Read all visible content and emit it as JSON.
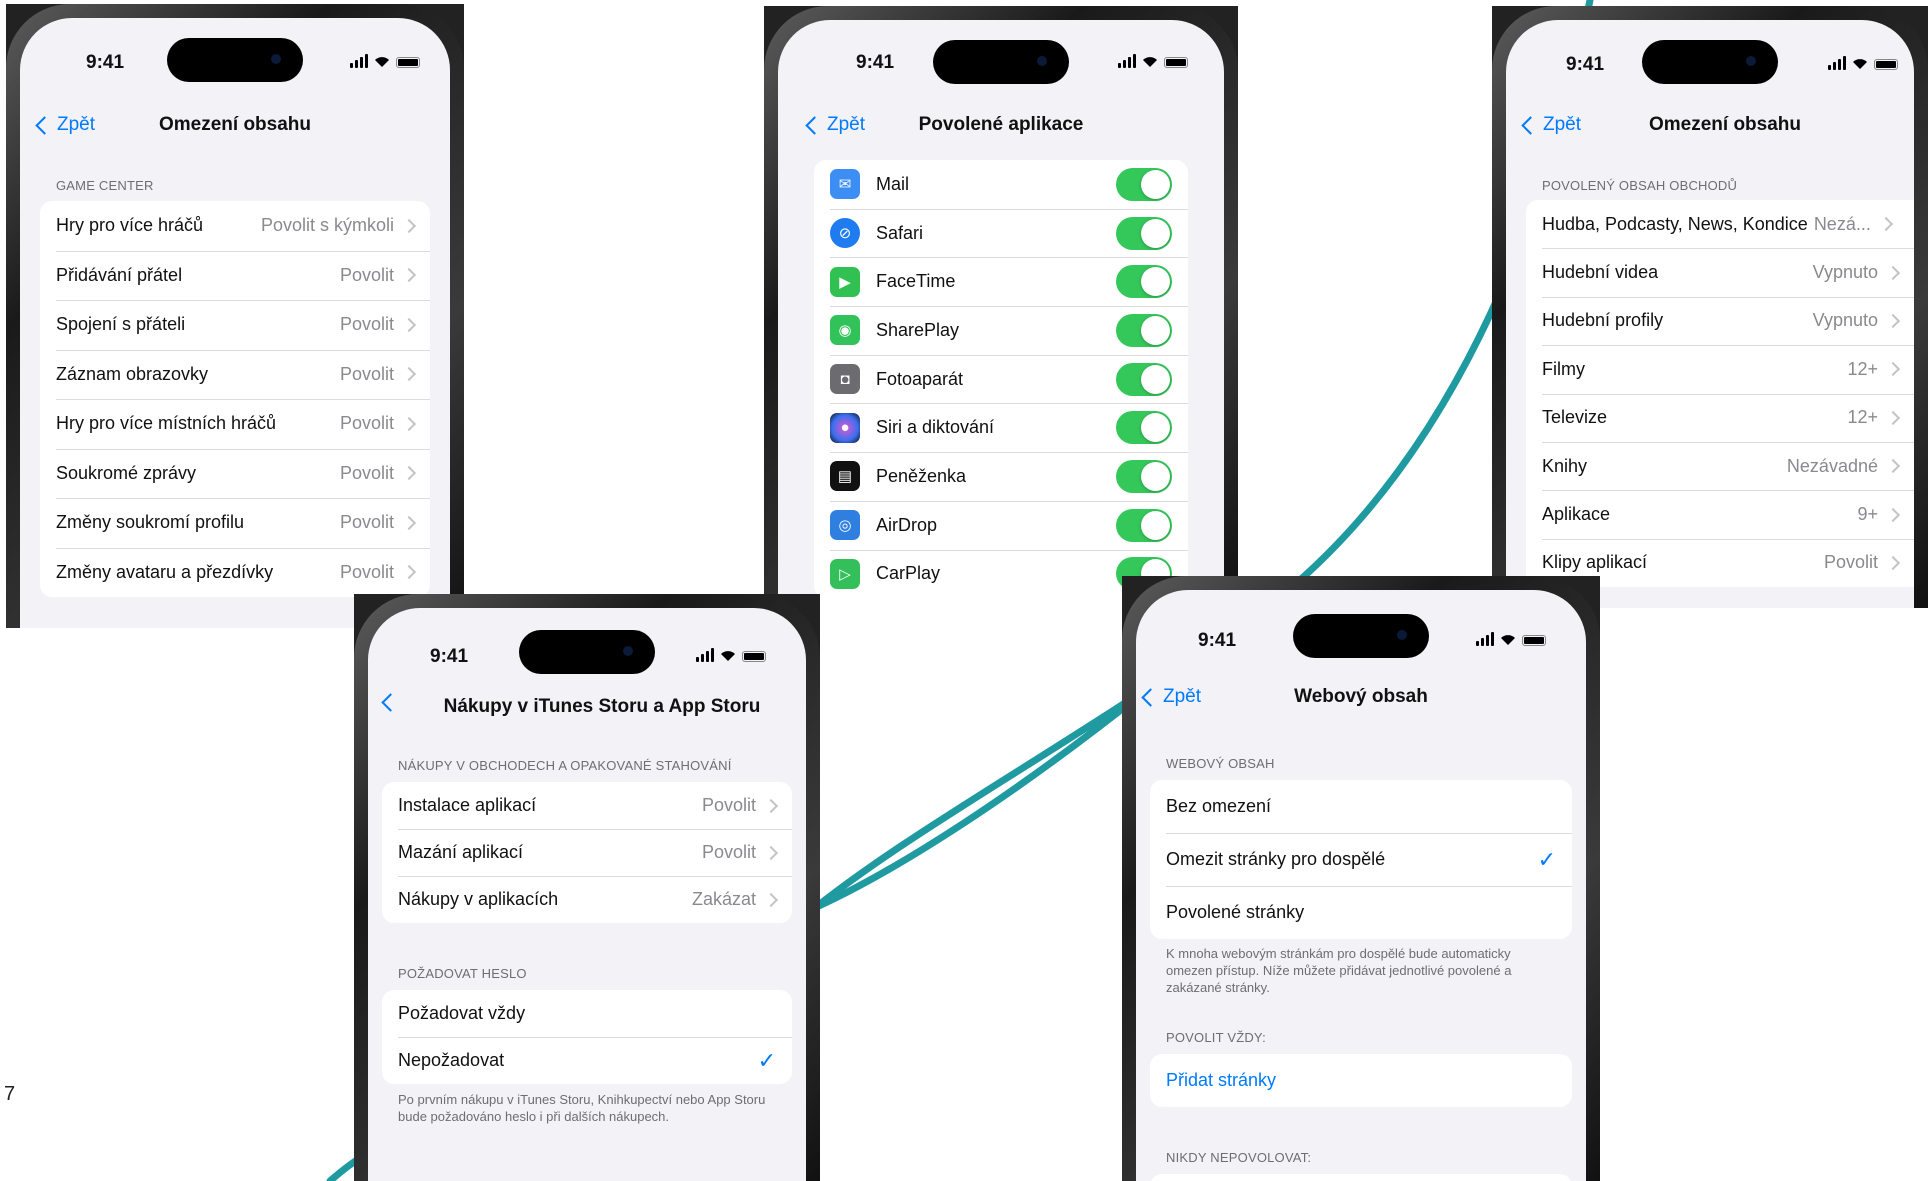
{
  "page_number": "7",
  "accent_color": "#1f9aa0",
  "status_time": "9:41",
  "phones": [
    {
      "id": "content-restrictions-gamecenter",
      "back": "Zpět",
      "title": "Omezení obsahu",
      "section": "GAME CENTER",
      "rows": [
        {
          "label": "Hry pro více hráčů",
          "value": "Povolit s kýmkoli"
        },
        {
          "label": "Přidávání přátel",
          "value": "Povolit"
        },
        {
          "label": "Spojení s přáteli",
          "value": "Povolit"
        },
        {
          "label": "Záznam obrazovky",
          "value": "Povolit"
        },
        {
          "label": "Hry pro více místních hráčů",
          "value": "Povolit"
        },
        {
          "label": "Soukromé zprávy",
          "value": "Povolit"
        },
        {
          "label": "Změny soukromí profilu",
          "value": "Povolit"
        },
        {
          "label": "Změny avataru a přezdívky",
          "value": "Povolit"
        }
      ]
    },
    {
      "id": "allowed-apps",
      "back": "Zpět",
      "title": "Povolené aplikace",
      "apps": [
        {
          "label": "Mail",
          "icon": "mail-icon",
          "color": "#3c8ef5",
          "on": true
        },
        {
          "label": "Safari",
          "icon": "safari-icon",
          "color": "#1e7cf0",
          "on": true
        },
        {
          "label": "FaceTime",
          "icon": "facetime-icon",
          "color": "#30c152",
          "on": true
        },
        {
          "label": "SharePlay",
          "icon": "shareplay-icon",
          "color": "#31c35a",
          "on": true
        },
        {
          "label": "Fotoaparát",
          "icon": "camera-icon",
          "color": "#6b6b70",
          "on": true
        },
        {
          "label": "Siri a diktování",
          "icon": "siri-icon",
          "color": "#6a3fd8",
          "on": true
        },
        {
          "label": "Peněženka",
          "icon": "wallet-icon",
          "color": "#111111",
          "on": true
        },
        {
          "label": "AirDrop",
          "icon": "airdrop-icon",
          "color": "#2f7fe0",
          "on": true
        },
        {
          "label": "CarPlay",
          "icon": "carplay-icon",
          "color": "#33c05a",
          "on": true
        }
      ]
    },
    {
      "id": "content-restrictions-store",
      "back": "Zpět",
      "title": "Omezení obsahu",
      "section": "POVOLENÝ OBSAH OBCHODŮ",
      "rows": [
        {
          "label": "Hudba, Podcasty, News, Kondice",
          "value": "Nezá..."
        },
        {
          "label": "Hudební videa",
          "value": "Vypnuto"
        },
        {
          "label": "Hudební profily",
          "value": "Vypnuto"
        },
        {
          "label": "Filmy",
          "value": "12+"
        },
        {
          "label": "Televize",
          "value": "12+"
        },
        {
          "label": "Knihy",
          "value": "Nezávadné"
        },
        {
          "label": "Aplikace",
          "value": "9+"
        },
        {
          "label": "Klipy aplikací",
          "value": "Povolit"
        }
      ]
    },
    {
      "id": "itunes-appstore-purchases",
      "title": "Nákupy v iTunes Storu a App Storu",
      "section1": "NÁKUPY V OBCHODECH A OPAKOVANÉ STAHOVÁNÍ",
      "rows1": [
        {
          "label": "Instalace aplikací",
          "value": "Povolit"
        },
        {
          "label": "Mazání aplikací",
          "value": "Povolit"
        },
        {
          "label": "Nákupy v aplikacích",
          "value": "Zakázat"
        }
      ],
      "section2": "POŽADOVAT HESLO",
      "rows2": [
        {
          "label": "Požadovat vždy",
          "checked": false
        },
        {
          "label": "Nepožadovat",
          "checked": true
        }
      ],
      "footnote": "Po prvním nákupu v iTunes Storu, Knihkupectví nebo App Storu bude požadováno heslo i při dalších nákupech."
    },
    {
      "id": "web-content",
      "back": "Zpět",
      "title": "Webový obsah",
      "section1": "WEBOVÝ OBSAH",
      "rows1": [
        {
          "label": "Bez omezení",
          "checked": false
        },
        {
          "label": "Omezit stránky pro dospělé",
          "checked": true
        },
        {
          "label": "Povolené stránky",
          "checked": false
        }
      ],
      "footnote": "K mnoha webovým stránkám pro dospělé bude automaticky omezen přístup. Níže můžete přidávat jednotlivé povolené a zakázané stránky.",
      "section2": "POVOLIT VŽDY:",
      "add_link": "Přidat stránky",
      "section3": "NIKDY NEPOVOLOVAT:"
    }
  ]
}
